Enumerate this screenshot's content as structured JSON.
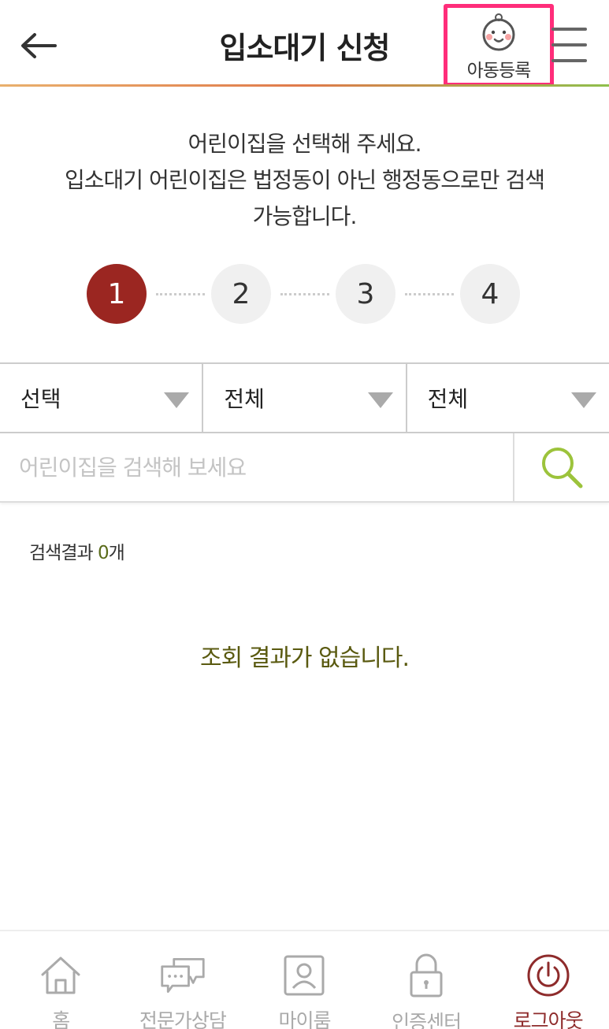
{
  "header": {
    "title": "입소대기 신청",
    "child_register_label": "아동등록"
  },
  "instruction": {
    "line1": "어린이집을 선택해 주세요.",
    "line2": "입소대기 어린이집은 법정동이 아닌 행정동으로만 검색",
    "line3": "가능합니다."
  },
  "steps": [
    "1",
    "2",
    "3",
    "4"
  ],
  "active_step": "1",
  "filters": [
    {
      "selected": "선택"
    },
    {
      "selected": "전체"
    },
    {
      "selected": "전체"
    }
  ],
  "search": {
    "placeholder": "어린이집을 검색해 보세요",
    "value": ""
  },
  "results": {
    "prefix": "검색결과 ",
    "count": "0",
    "suffix": "개",
    "empty_message": "조회 결과가 없습니다."
  },
  "bottom_nav": {
    "items": [
      {
        "label": "홈",
        "icon": "home-icon"
      },
      {
        "label": "전문가상담",
        "icon": "chat-icon"
      },
      {
        "label": "마이룸",
        "icon": "user-icon"
      },
      {
        "label": "인증센터",
        "icon": "lock-icon"
      },
      {
        "label": "로그아웃",
        "icon": "power-icon"
      }
    ],
    "active": "로그아웃"
  },
  "colors": {
    "active_step": "#9b2621",
    "highlight_border": "#ff2d7a",
    "search_icon": "#9cc33b",
    "logout_accent": "#8e2b2b"
  }
}
